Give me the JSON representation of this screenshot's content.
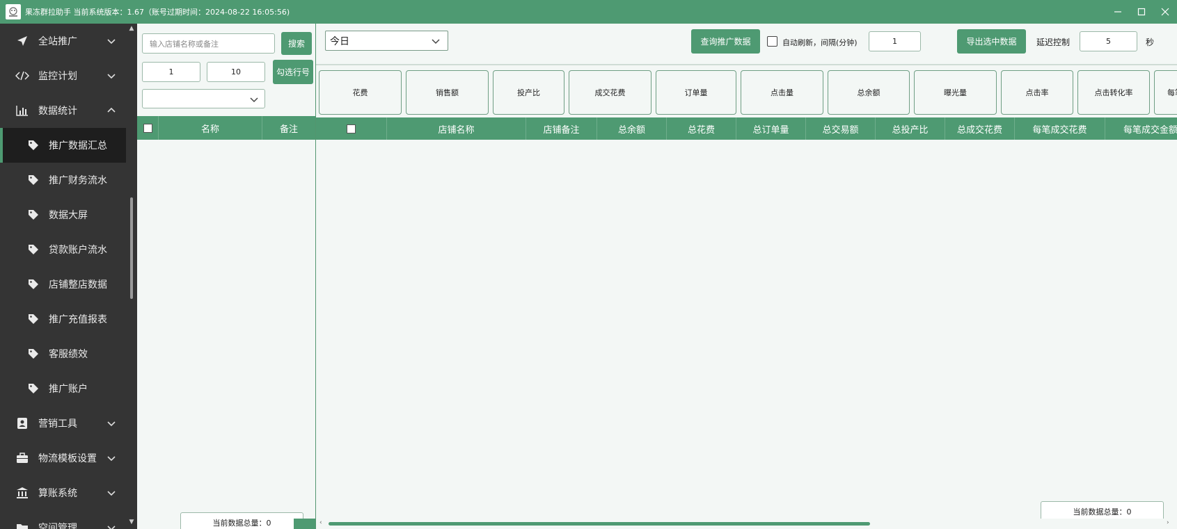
{
  "window": {
    "title": "果冻群拉助手 当前系统版本：1.67（账号过期时间：2024-08-22 16:05:56)",
    "minimize_icon": "minimize-icon",
    "maximize_icon": "maximize-icon",
    "close_icon": "close-icon"
  },
  "sidebar": {
    "items": [
      {
        "label": "全站推广",
        "icon": "send-icon",
        "expanded": false
      },
      {
        "label": "监控计划",
        "icon": "code-icon",
        "expanded": false
      },
      {
        "label": "数据统计",
        "icon": "bar-chart-icon",
        "expanded": true
      },
      {
        "label": "营销工具",
        "icon": "contact-card-icon",
        "expanded": false
      },
      {
        "label": "物流模板设置",
        "icon": "briefcase-icon",
        "expanded": false
      },
      {
        "label": "算账系统",
        "icon": "bank-icon",
        "expanded": false
      },
      {
        "label": "空间管理",
        "icon": "folder-icon",
        "expanded": false
      }
    ],
    "sub_items": [
      {
        "label": "推广数据汇总",
        "active": true
      },
      {
        "label": "推广财务流水"
      },
      {
        "label": "数据大屏"
      },
      {
        "label": "贷款账户流水"
      },
      {
        "label": "店铺整店数据"
      },
      {
        "label": "推广充值报表"
      },
      {
        "label": "客服绩效"
      },
      {
        "label": "推广账户"
      }
    ]
  },
  "left_panel": {
    "search_placeholder": "输入店铺名称或备注",
    "search_button": "搜索",
    "range_from": "1",
    "range_to": "10",
    "select_rows_button": "勾选行号",
    "dropdown_value": "",
    "table_headers": [
      "名称",
      "备注"
    ],
    "total_label": "当前数据总量：0",
    "collapse_label": "< <"
  },
  "right_panel": {
    "date_select": "今日",
    "query_button": "查询推广数据",
    "auto_refresh_label": "自动刷新，间隔(分钟)",
    "auto_refresh_checked": false,
    "interval_value": "1",
    "export_button": "导出选中数据",
    "delay_label": "延迟控制",
    "delay_value": "5",
    "delay_unit": "秒",
    "metrics": [
      "花费",
      "销售额",
      "投产比",
      "成交花费",
      "订单量",
      "点击量",
      "总余额",
      "曝光量",
      "点击率",
      "点击转化率",
      "每笔成交花费"
    ],
    "table_headers": [
      "店铺名称",
      "店铺备注",
      "总余额",
      "总花费",
      "总订单量",
      "总交易额",
      "总投产比",
      "总成交花费",
      "每笔成交花费",
      "每笔成交金额"
    ],
    "total_label": "当前数据总量：0"
  },
  "colors": {
    "accent": "#4e9a72",
    "sidebar_bg": "#343434",
    "panel_bg": "#f3f7f5"
  }
}
